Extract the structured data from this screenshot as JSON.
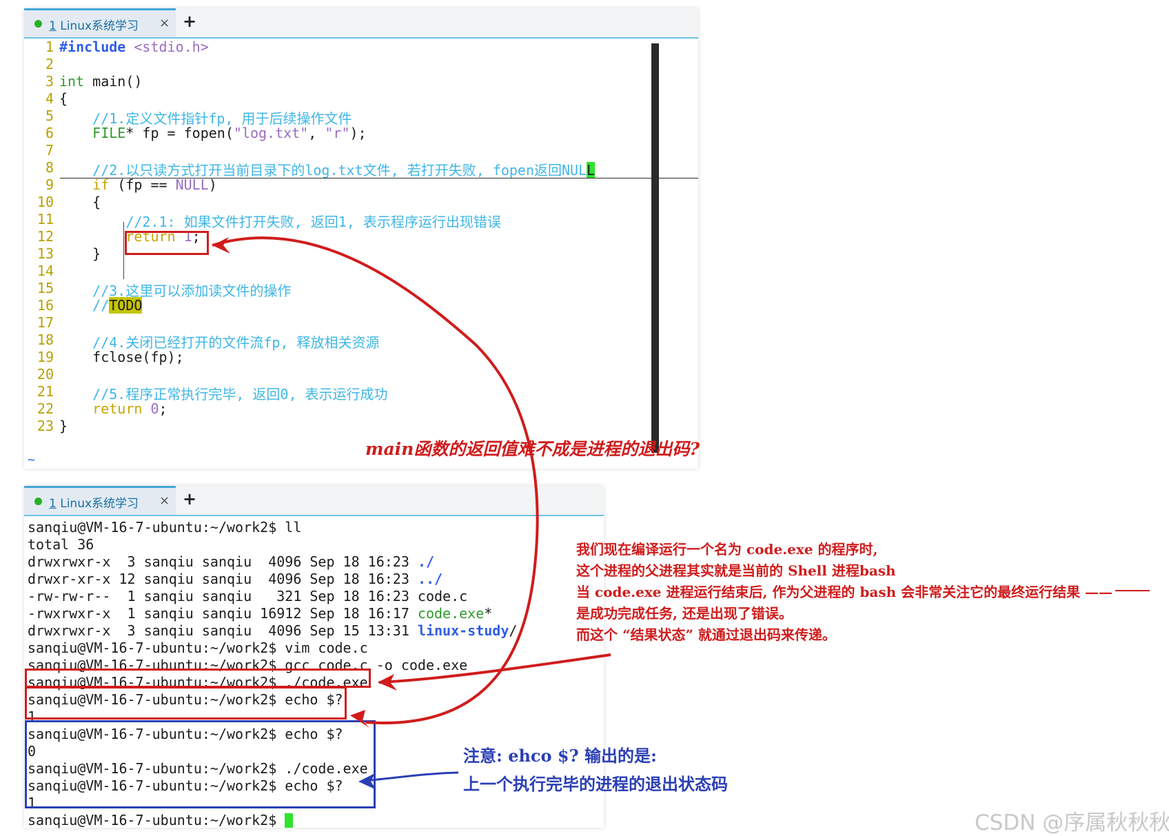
{
  "editor": {
    "tab": {
      "index": "1",
      "title": " Linux系统学习",
      "close": "×",
      "add": "+"
    },
    "lines": [
      {
        "n": "1",
        "parts": [
          [
            "#include",
            "kw-inc"
          ],
          [
            " ",
            ""
          ],
          [
            "<stdio.h>",
            "str"
          ]
        ]
      },
      {
        "n": "2",
        "parts": []
      },
      {
        "n": "3",
        "parts": [
          [
            "int",
            "type"
          ],
          [
            " main()",
            ""
          ]
        ]
      },
      {
        "n": "4",
        "parts": [
          [
            "{",
            ""
          ]
        ]
      },
      {
        "n": "5",
        "parts": [
          [
            "    ",
            ""
          ],
          [
            "//1.定义文件指针fp, 用于后续操作文件",
            "cm"
          ]
        ]
      },
      {
        "n": "6",
        "parts": [
          [
            "    ",
            ""
          ],
          [
            "FILE",
            "type"
          ],
          [
            "* fp = fopen(",
            ""
          ],
          [
            "\"log.txt\"",
            "str"
          ],
          [
            ", ",
            ""
          ],
          [
            "\"r\"",
            "str"
          ],
          [
            ");",
            ""
          ]
        ]
      },
      {
        "n": "7",
        "parts": []
      },
      {
        "n": "8",
        "parts": [
          [
            "    ",
            ""
          ],
          [
            "//2.以只读方式打开当前目录下的log.txt文件, 若打开失败, fopen返回NUL",
            "cm"
          ],
          [
            "L",
            "cursor-green"
          ]
        ]
      },
      {
        "n": "9",
        "parts": [
          [
            "    ",
            ""
          ],
          [
            "if",
            "ctl"
          ],
          [
            " (fp == ",
            ""
          ],
          [
            "NULL",
            "str"
          ],
          [
            ")",
            ""
          ]
        ]
      },
      {
        "n": "10",
        "parts": [
          [
            "    {",
            ""
          ]
        ]
      },
      {
        "n": "11",
        "parts": [
          [
            "        ",
            ""
          ],
          [
            "//2.1: 如果文件打开失败, 返回1, 表示程序运行出现错误",
            "cm"
          ]
        ]
      },
      {
        "n": "12",
        "parts": [
          [
            "        ",
            ""
          ],
          [
            "return",
            "ctl"
          ],
          [
            " ",
            ""
          ],
          [
            "1",
            "num"
          ],
          [
            ";",
            ""
          ]
        ]
      },
      {
        "n": "13",
        "parts": [
          [
            "    }",
            ""
          ]
        ]
      },
      {
        "n": "14",
        "parts": []
      },
      {
        "n": "15",
        "parts": [
          [
            "    ",
            ""
          ],
          [
            "//3.这里可以添加读文件的操作",
            "cm"
          ]
        ]
      },
      {
        "n": "16",
        "parts": [
          [
            "    ",
            ""
          ],
          [
            "//",
            "cm"
          ],
          [
            "TODO",
            "todo"
          ]
        ]
      },
      {
        "n": "17",
        "parts": []
      },
      {
        "n": "18",
        "parts": [
          [
            "    ",
            ""
          ],
          [
            "//4.关闭已经打开的文件流fp, 释放相关资源",
            "cm"
          ]
        ]
      },
      {
        "n": "19",
        "parts": [
          [
            "    fclose(fp);",
            ""
          ]
        ]
      },
      {
        "n": "20",
        "parts": []
      },
      {
        "n": "21",
        "parts": [
          [
            "    ",
            ""
          ],
          [
            "//5.程序正常执行完毕, 返回0, 表示运行成功",
            "cm"
          ]
        ]
      },
      {
        "n": "22",
        "parts": [
          [
            "    ",
            ""
          ],
          [
            "return",
            "ctl"
          ],
          [
            " ",
            ""
          ],
          [
            "0",
            "num"
          ],
          [
            ";",
            ""
          ]
        ]
      },
      {
        "n": "23",
        "parts": [
          [
            "}",
            ""
          ]
        ]
      }
    ],
    "tilde": "~"
  },
  "terminal": {
    "tab": {
      "index": "1",
      "title": " Linux系统学习",
      "close": "×",
      "add": "+"
    },
    "lines": [
      [
        [
          "sanqiu@VM-16-7-ubuntu:~/work2$ ll",
          ""
        ]
      ],
      [
        [
          "total 36",
          ""
        ]
      ],
      [
        [
          "drwxrwxr-x  3 sanqiu sanqiu  4096 Sep 18 16:23 ",
          ""
        ],
        [
          "./",
          "dir"
        ]
      ],
      [
        [
          "drwxr-xr-x 12 sanqiu sanqiu  4096 Sep 18 16:23 ",
          ""
        ],
        [
          "../",
          "dir"
        ]
      ],
      [
        [
          "-rw-rw-r--  1 sanqiu sanqiu   321 Sep 18 16:23 code.c",
          ""
        ]
      ],
      [
        [
          "-rwxrwxr-x  1 sanqiu sanqiu 16912 Sep 18 16:17 ",
          ""
        ],
        [
          "code.exe",
          "exe"
        ],
        [
          "*",
          ""
        ]
      ],
      [
        [
          "drwxrwxr-x  3 sanqiu sanqiu  4096 Sep 15 13:31 ",
          ""
        ],
        [
          "linux-study",
          "dir"
        ],
        [
          "/",
          ""
        ]
      ],
      [
        [
          "sanqiu@VM-16-7-ubuntu:~/work2$ vim code.c",
          ""
        ]
      ],
      [
        [
          "sanqiu@VM-16-7-ubuntu:~/work2$ gcc code.c -o code.exe",
          ""
        ]
      ],
      [
        [
          "sanqiu@VM-16-7-ubuntu:~/work2$ ./code.exe",
          ""
        ]
      ],
      [
        [
          "sanqiu@VM-16-7-ubuntu:~/work2$ echo $?",
          ""
        ]
      ],
      [
        [
          "1",
          ""
        ]
      ],
      [
        [
          "sanqiu@VM-16-7-ubuntu:~/work2$ echo $?",
          ""
        ]
      ],
      [
        [
          "0",
          ""
        ]
      ],
      [
        [
          "sanqiu@VM-16-7-ubuntu:~/work2$ ./code.exe",
          ""
        ]
      ],
      [
        [
          "sanqiu@VM-16-7-ubuntu:~/work2$ echo $?",
          ""
        ]
      ],
      [
        [
          "1",
          ""
        ]
      ],
      [
        [
          "sanqiu@VM-16-7-ubuntu:~/work2$ ",
          ""
        ]
      ]
    ]
  },
  "annotations": {
    "question": "main函数的返回值难不成是进程的退出码?",
    "explain": [
      "我们现在编译运行一个名为 code.exe 的程序时,",
      "这个进程的父进程其实就是当前的 Shell 进程bash",
      "当 code.exe 进程运行结束后, 作为父进程的 bash 会非常关注它的最终运行结果 ——",
      "是成功完成任务, 还是出现了错误。",
      "而这个 “结果状态” 就通过退出码来传递。"
    ],
    "note": [
      "注意: ehco $? 输出的是:",
      "上一个执行完毕的进程的退出状态码"
    ],
    "watermark": "CSDN @序属秋秋秋"
  },
  "colors": {
    "red_annotation": "#d01c1c",
    "blue_annotation": "#2b3fb5",
    "tab_accent": "#45a6d8",
    "cursor": "#2ee42e"
  }
}
